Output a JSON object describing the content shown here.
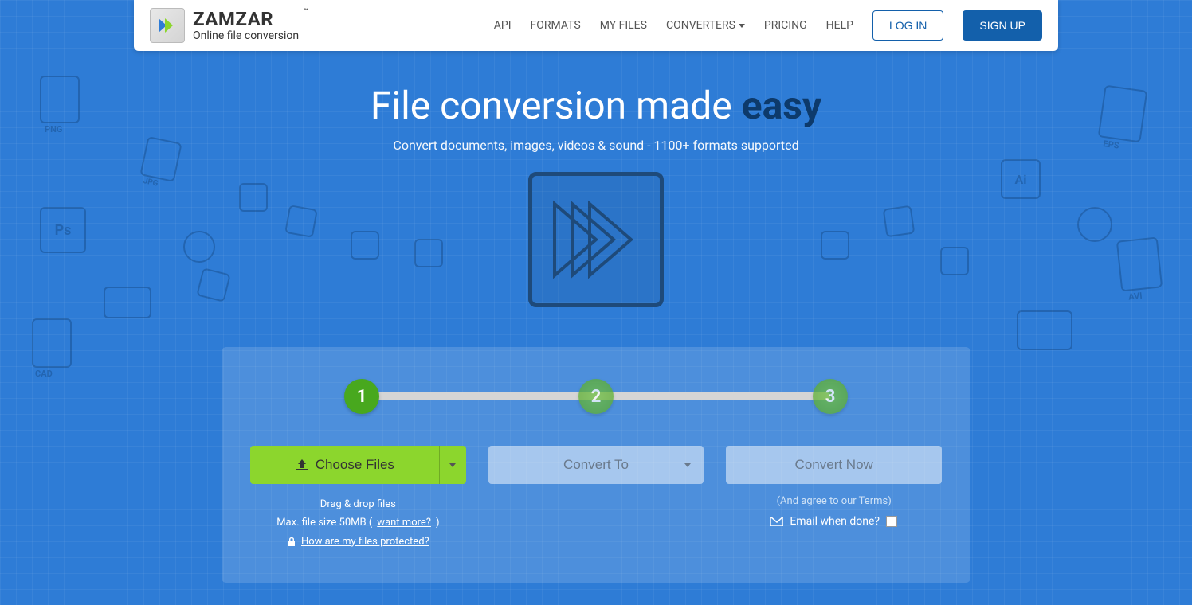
{
  "brand": {
    "name": "ZAMZAR",
    "tm": "™",
    "tagline": "Online file conversion"
  },
  "nav": {
    "api": "API",
    "formats": "FORMATS",
    "myfiles": "MY FILES",
    "converters": "CONVERTERS",
    "pricing": "PRICING",
    "help": "HELP",
    "login": "LOG IN",
    "signup": "SIGN UP"
  },
  "hero": {
    "title_pre": "File conversion made ",
    "title_em": "easy",
    "subtitle": "Convert documents, images, videos & sound - 1100+ formats supported"
  },
  "steps": {
    "s1": "1",
    "s2": "2",
    "s3": "3"
  },
  "converter": {
    "choose": "Choose Files",
    "convert_to": "Convert To",
    "convert_now": "Convert Now",
    "drag": "Drag & drop files",
    "maxsize_pre": "Max. file size 50MB (",
    "want_more": "want more?",
    "maxsize_post": ")",
    "protected": "How are my files protected?",
    "agree_pre": "(And agree to our ",
    "terms": "Terms",
    "agree_post": ")",
    "email_label": "Email when done?"
  }
}
